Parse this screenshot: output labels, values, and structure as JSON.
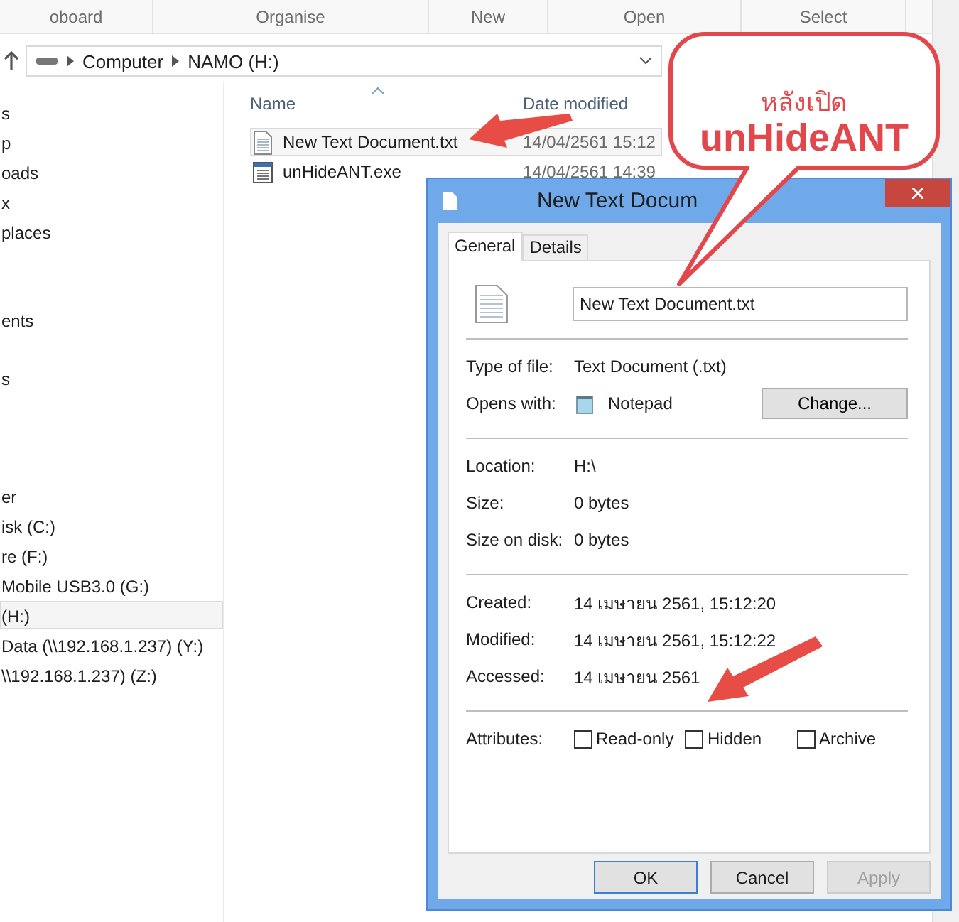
{
  "ribbon": {
    "groups": [
      "oboard",
      "Organise",
      "New",
      "Open",
      "Select"
    ]
  },
  "address_bar": {
    "path": [
      "Computer",
      "NAMO (H:)"
    ]
  },
  "nav_pane": {
    "groups": [
      {
        "items": [
          {
            "label": "s",
            "selected": false
          },
          {
            "label": "p",
            "selected": false
          },
          {
            "label": "oads",
            "selected": false
          },
          {
            "label": "x",
            "selected": false
          },
          {
            "label": "places",
            "selected": false
          }
        ]
      },
      {
        "items": [
          {
            "label": "ents",
            "selected": false
          }
        ]
      },
      {
        "items": [
          {
            "label": "s",
            "selected": false
          }
        ]
      },
      {
        "items": [
          {
            "label": "er",
            "selected": false
          },
          {
            "label": "isk (C:)",
            "selected": false
          },
          {
            "label": "re (F:)",
            "selected": false
          },
          {
            "label": "Mobile USB3.0  (G:)",
            "selected": false
          },
          {
            "label": "(H:)",
            "selected": true
          },
          {
            "label": "Data (\\\\192.168.1.237) (Y:)",
            "selected": false
          },
          {
            "label": "\\\\192.168.1.237) (Z:)",
            "selected": false
          }
        ]
      }
    ]
  },
  "file_list": {
    "columns": [
      "Name",
      "Date modified"
    ],
    "rows": [
      {
        "name": "New Text Document.txt",
        "date": "14/04/2561 15:12",
        "kind": "text",
        "hovered": true
      },
      {
        "name": "unHideANT.exe",
        "date": "14/04/2561 14:39",
        "kind": "program",
        "hovered": false
      }
    ]
  },
  "dialog": {
    "title": "New Text Docum",
    "tabs": [
      {
        "label": "General",
        "selected": true
      },
      {
        "label": "Details",
        "selected": false
      }
    ],
    "file_name": "New Text Document.txt",
    "sections": [
      [
        {
          "label": "Type of file:",
          "value": "Text Document (.txt)"
        },
        {
          "label": "Opens with:",
          "value": "Notepad",
          "button": "Change..."
        }
      ],
      [
        {
          "label": "Location:",
          "value": "H:\\"
        },
        {
          "label": "Size:",
          "value": "0 bytes"
        },
        {
          "label": "Size on disk:",
          "value": "0 bytes"
        }
      ],
      [
        {
          "label": "Created:",
          "value": "14 เมษายน 2561, 15:12:20"
        },
        {
          "label": "Modified:",
          "value": "14 เมษายน 2561, 15:12:22"
        },
        {
          "label": "Accessed:",
          "value": "14 เมษายน 2561"
        }
      ]
    ],
    "attributes": {
      "label": "Attributes:",
      "items": [
        {
          "label": "Read-only",
          "checked": false
        },
        {
          "label": "Hidden",
          "checked": false
        },
        {
          "label": "Archive",
          "checked": false
        }
      ]
    },
    "buttons": [
      {
        "label": "OK",
        "default": true,
        "disabled": false
      },
      {
        "label": "Cancel",
        "default": false,
        "disabled": false
      },
      {
        "label": "Apply",
        "default": false,
        "disabled": true
      }
    ]
  },
  "callout": {
    "lines": [
      "หลังเปิด",
      "unHideANT"
    ]
  }
}
